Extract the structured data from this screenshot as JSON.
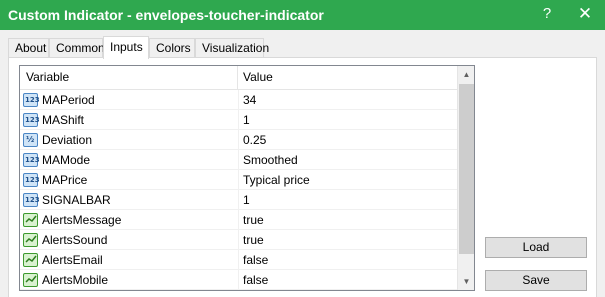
{
  "window": {
    "title": "Custom Indicator - envelopes-toucher-indicator",
    "help_label": "?",
    "close_label": "✕"
  },
  "tabs": [
    {
      "label": "About"
    },
    {
      "label": "Common"
    },
    {
      "label": "Inputs",
      "active": true
    },
    {
      "label": "Colors"
    },
    {
      "label": "Visualization"
    }
  ],
  "grid": {
    "headers": {
      "variable": "Variable",
      "value": "Value"
    },
    "rows": [
      {
        "name": "MAPeriod",
        "value": "34",
        "icon": "integer-icon"
      },
      {
        "name": "MAShift",
        "value": "1",
        "icon": "integer-icon"
      },
      {
        "name": "Deviation",
        "value": "0.25",
        "icon": "double-icon"
      },
      {
        "name": "MAMode",
        "value": "Smoothed",
        "icon": "integer-icon"
      },
      {
        "name": "MAPrice",
        "value": "Typical price",
        "icon": "integer-icon"
      },
      {
        "name": "SIGNALBAR",
        "value": "1",
        "icon": "integer-icon"
      },
      {
        "name": "AlertsMessage",
        "value": "true",
        "icon": "boolean-icon"
      },
      {
        "name": "AlertsSound",
        "value": "true",
        "icon": "boolean-icon"
      },
      {
        "name": "AlertsEmail",
        "value": "false",
        "icon": "boolean-icon"
      },
      {
        "name": "AlertsMobile",
        "value": "false",
        "icon": "boolean-icon"
      }
    ],
    "icon_text": {
      "integer": "123",
      "double": "½"
    }
  },
  "buttons": {
    "load_label": "Load",
    "save_label": "Save"
  },
  "colors": {
    "titlebar": "#2fa84f",
    "accent": "#4a86c5"
  }
}
